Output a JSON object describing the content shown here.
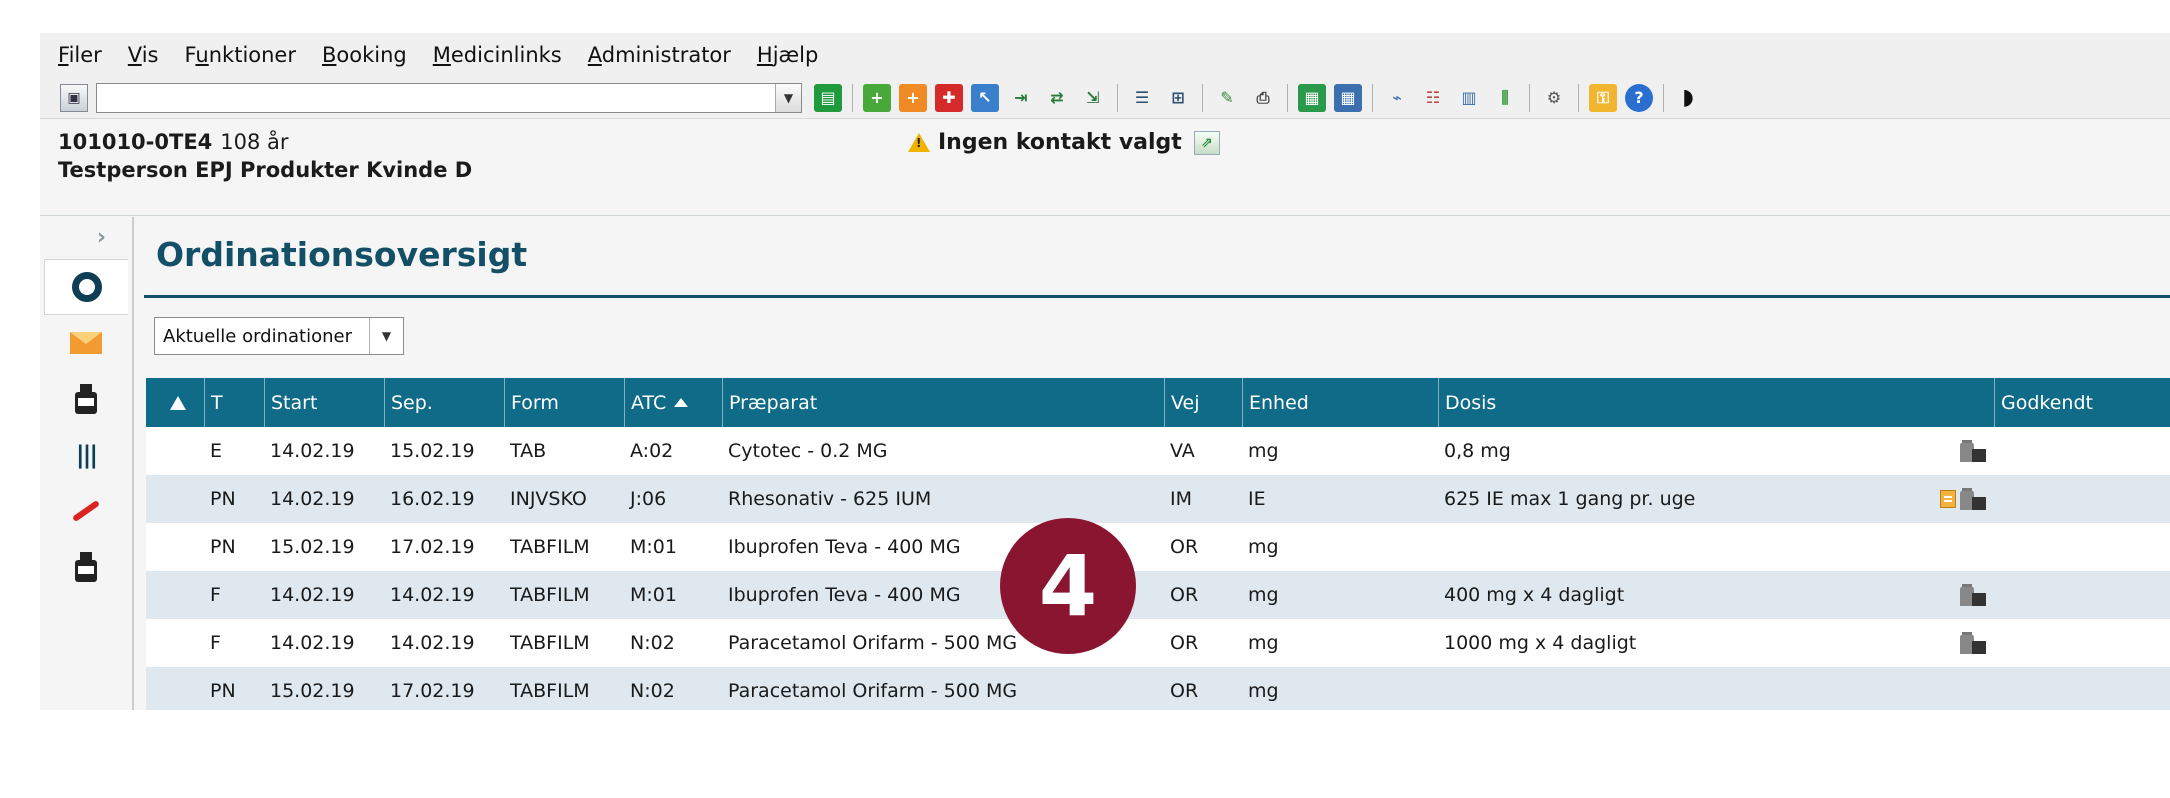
{
  "menu": [
    {
      "pre": "",
      "u": "F",
      "post": "iler"
    },
    {
      "pre": "",
      "u": "V",
      "post": "is"
    },
    {
      "pre": "F",
      "u": "u",
      "post": "nktioner"
    },
    {
      "pre": "",
      "u": "B",
      "post": "ooking"
    },
    {
      "pre": "",
      "u": "M",
      "post": "edicinlinks"
    },
    {
      "pre": "",
      "u": "A",
      "post": "dministrator"
    },
    {
      "pre": "",
      "u": "H",
      "post": "jælp"
    }
  ],
  "patient": {
    "cpr": "101010-0TE4",
    "age": "108 år",
    "name": "Testperson EPJ Produkter Kvinde D",
    "contact": "Ingen kontakt valgt"
  },
  "page": {
    "title": "Ordinationsoversigt",
    "filter": "Aktuelle ordinationer"
  },
  "table": {
    "headers": [
      "",
      "T",
      "Start",
      "Sep.",
      "Form",
      "ATC",
      "Præparat",
      "Vej",
      "Enhed",
      "Dosis",
      "Godkendt"
    ],
    "rows": [
      [
        "E",
        "14.02.19",
        "15.02.19",
        "TAB",
        "A:02",
        "Cytotec - 0.2 MG",
        "VA",
        "mg",
        "0,8 mg"
      ],
      [
        "PN",
        "14.02.19",
        "16.02.19",
        "INJVSKO",
        "J:06",
        "Rhesonativ - 625 IUM",
        "IM",
        "IE",
        "625 IE max 1 gang pr. uge"
      ],
      [
        "PN",
        "15.02.19",
        "17.02.19",
        "TABFILM",
        "M:01",
        "Ibuprofen Teva - 400 MG",
        "OR",
        "mg",
        ""
      ],
      [
        "F",
        "14.02.19",
        "14.02.19",
        "TABFILM",
        "M:01",
        "Ibuprofen Teva - 400 MG",
        "OR",
        "mg",
        "400 mg x 4 dagligt"
      ],
      [
        "F",
        "14.02.19",
        "14.02.19",
        "TABFILM",
        "N:02",
        "Paracetamol Orifarm - 500 MG",
        "OR",
        "mg",
        "1000 mg x 4 dagligt"
      ],
      [
        "PN",
        "15.02.19",
        "17.02.19",
        "TABFILM",
        "N:02",
        "Paracetamol Orifarm - 500 MG",
        "OR",
        "mg",
        ""
      ]
    ]
  },
  "badge": "4"
}
